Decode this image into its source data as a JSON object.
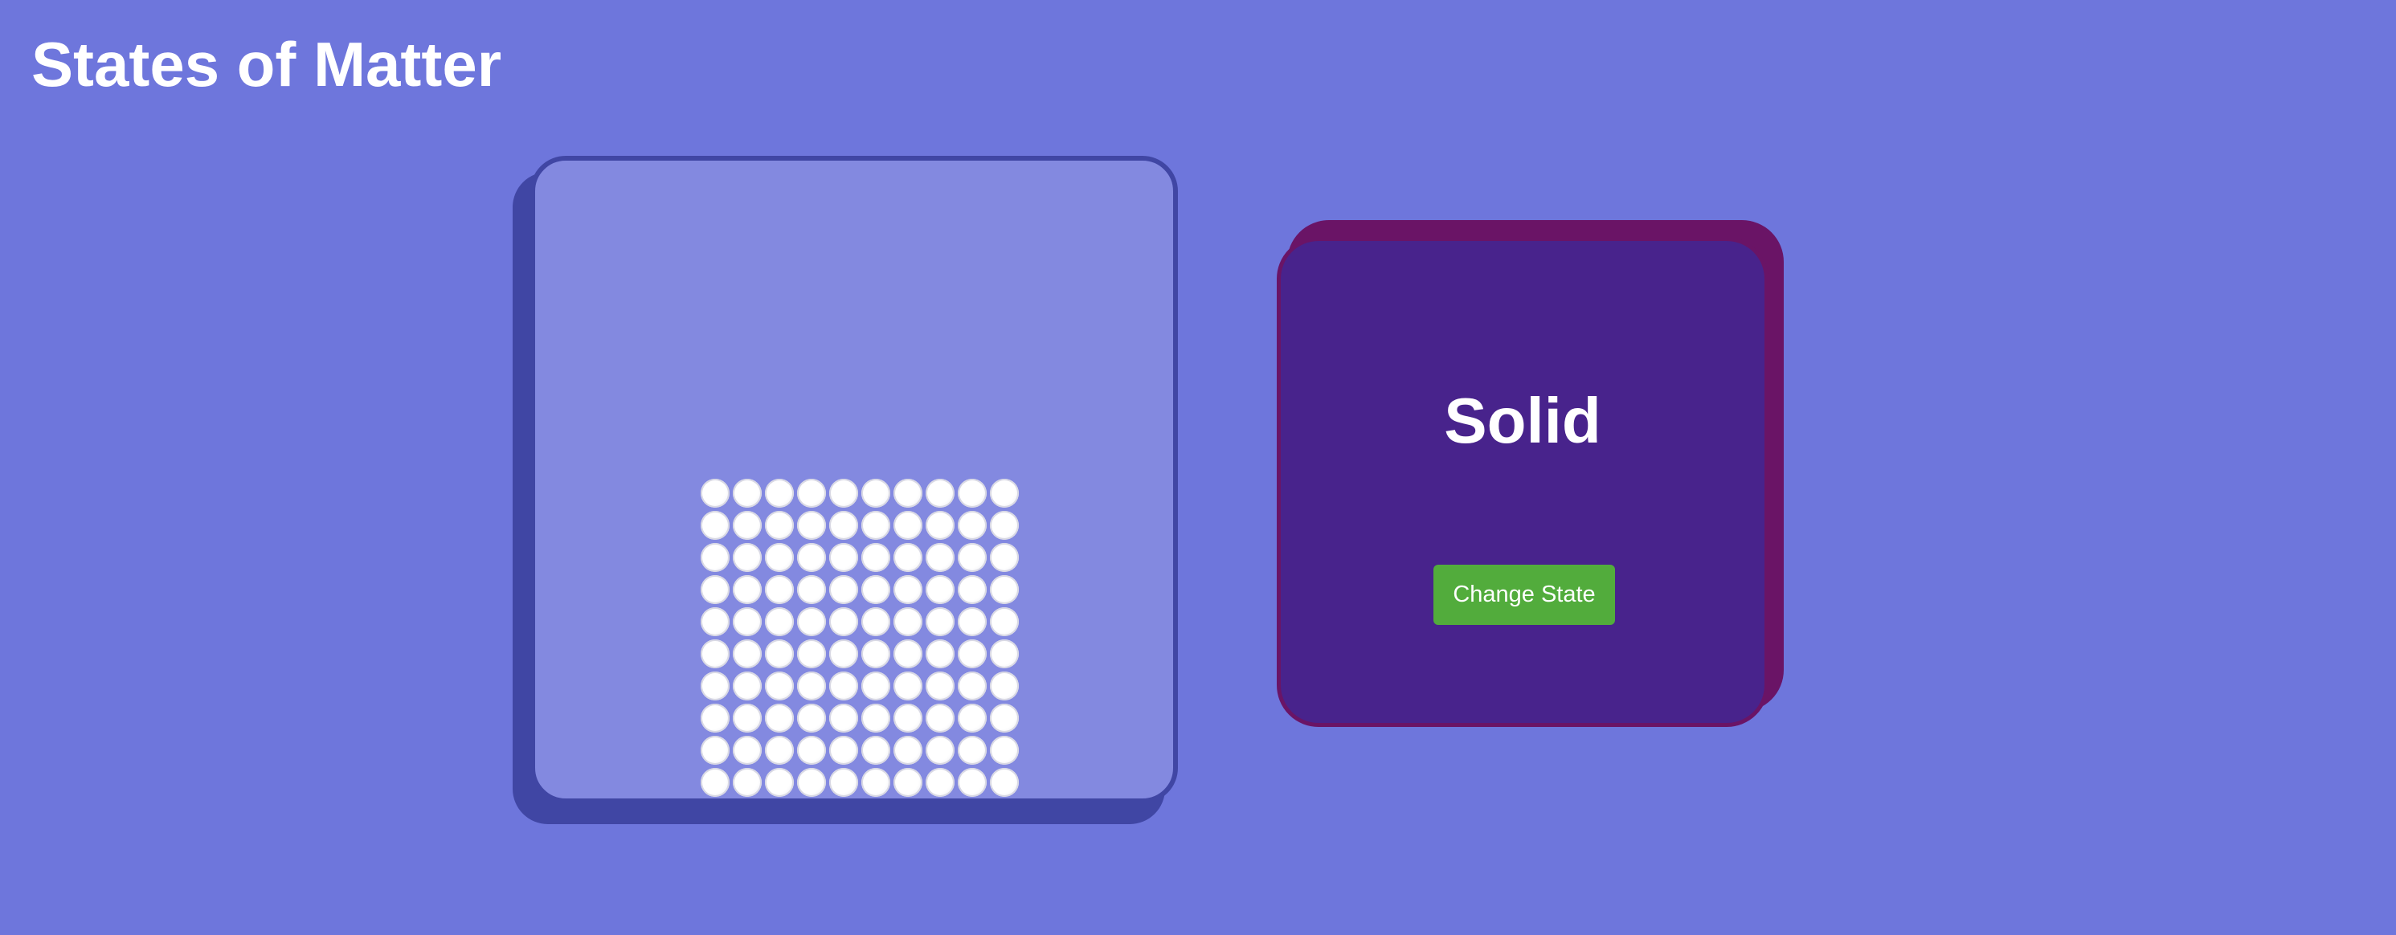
{
  "page": {
    "title": "States of Matter"
  },
  "container": {
    "state": "solid",
    "particle_grid": {
      "columns": 10,
      "rows": 10
    }
  },
  "state_card": {
    "state_label": "Solid",
    "change_button_label": "Change State"
  },
  "colors": {
    "background": "#6e76dc",
    "container_fill": "#8389e0",
    "container_border": "#4046a4",
    "particle": "#ffffff",
    "card_fill": "#48238c",
    "card_border": "#6a1466",
    "button": "#52ac3c"
  }
}
